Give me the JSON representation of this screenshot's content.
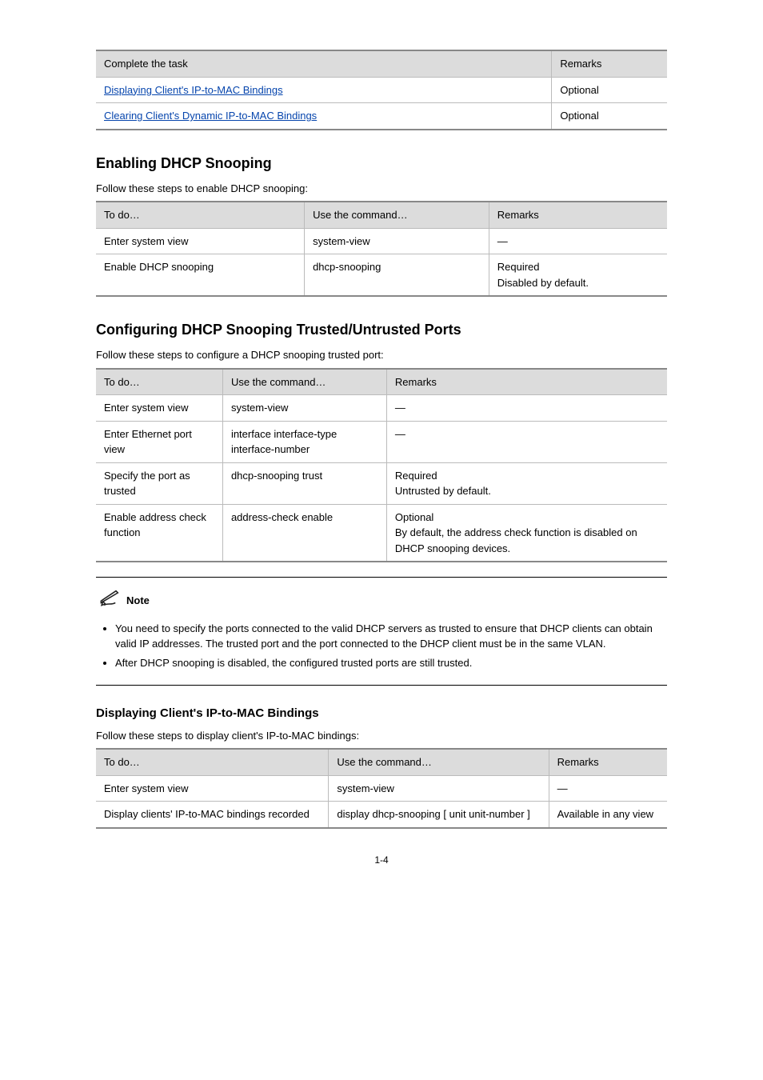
{
  "tableA": {
    "headers": [
      "Complete the task",
      "Remarks"
    ],
    "rows": [
      [
        {
          "type": "link",
          "text": "Displaying Client's IP-to-MAC Bindings"
        },
        "Optional"
      ],
      [
        {
          "type": "link",
          "text": "Clearing Client's Dynamic IP-to-MAC Bindings"
        },
        "Optional"
      ]
    ]
  },
  "sectionA": {
    "title": "Enabling DHCP Snooping",
    "intro": "Follow these steps to enable DHCP snooping:",
    "table": {
      "headers": [
        "To do…",
        "Use the command…",
        "Remarks"
      ],
      "rows": [
        [
          "Enter system view",
          "system-view",
          "—"
        ],
        [
          "Enable DHCP snooping",
          "dhcp-snooping",
          "Required\nDisabled by default."
        ]
      ]
    }
  },
  "sectionB": {
    "title": "Configuring DHCP Snooping Trusted/Untrusted Ports",
    "intro": "Follow these steps to configure a DHCP snooping trusted port:",
    "table": {
      "headers": [
        "To do…",
        "Use the command…",
        "Remarks"
      ],
      "rows": [
        [
          "Enter system view",
          "system-view",
          "—"
        ],
        [
          "Enter Ethernet port view",
          "interface interface-type interface-number",
          "—"
        ],
        [
          "Specify the port as trusted",
          "dhcp-snooping trust",
          "Required\nUntrusted by default."
        ],
        [
          "Enable address check function",
          "address-check enable",
          "Optional\nBy default, the address check function is disabled on DHCP snooping devices."
        ]
      ]
    }
  },
  "note": {
    "label": "Note",
    "items": [
      "You need to specify the ports connected to the valid DHCP servers as trusted to ensure that DHCP clients can obtain valid IP addresses. The trusted port and the port connected to the DHCP client must be in the same VLAN.",
      "After DHCP snooping is disabled, the configured trusted ports are still trusted."
    ]
  },
  "sectionC": {
    "title": "Displaying Client's IP-to-MAC Bindings",
    "intro": "Follow these steps to display client's IP-to-MAC bindings:",
    "table": {
      "headers": [
        "To do…",
        "Use the command…",
        "Remarks"
      ],
      "rows": [
        [
          "Enter system view",
          "system-view",
          "—"
        ],
        [
          "Display clients' IP-to-MAC bindings recorded",
          "display dhcp-snooping [ unit unit-number ]",
          "Available in any view"
        ]
      ]
    }
  },
  "pagenum": "1-4"
}
